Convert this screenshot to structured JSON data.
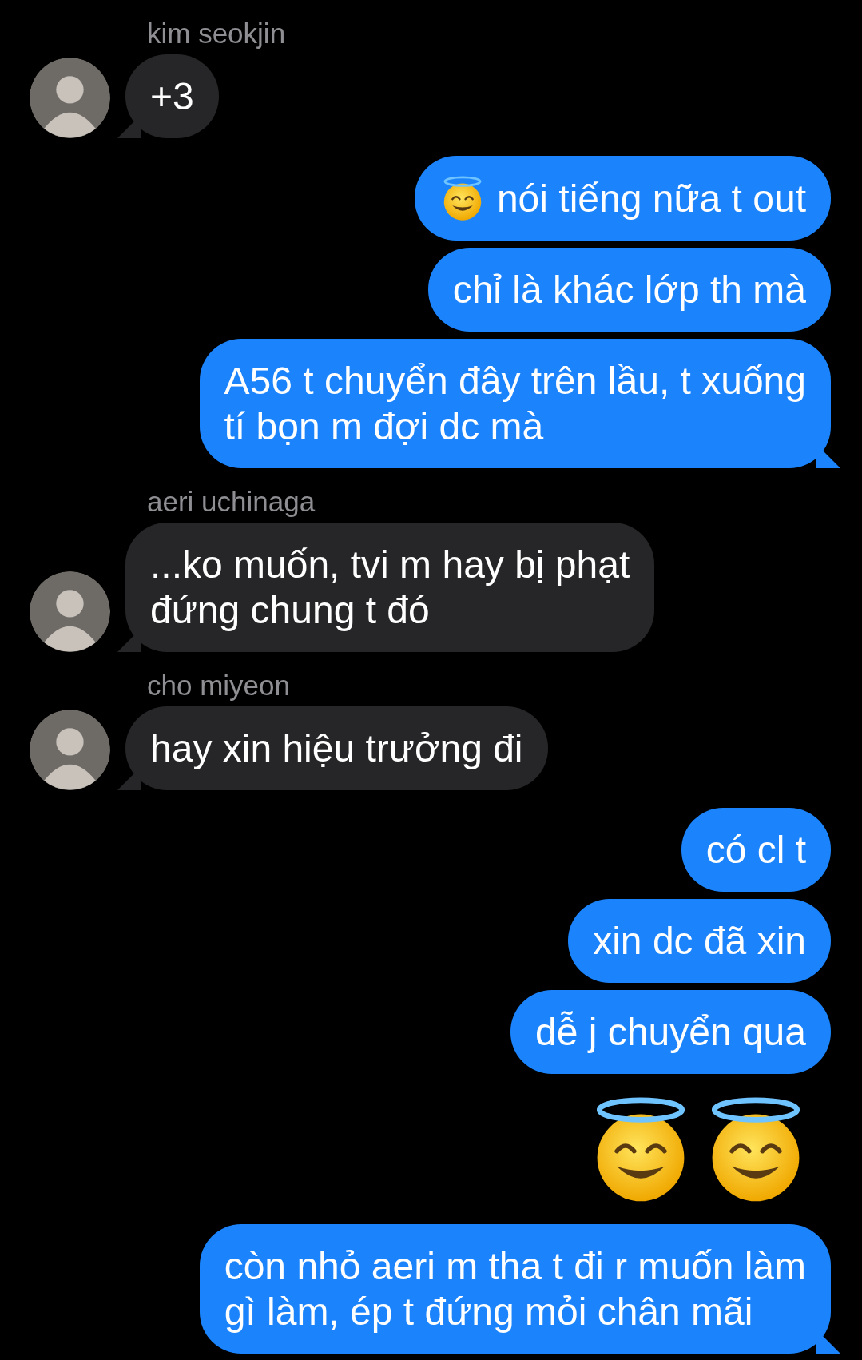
{
  "messages": [
    {
      "kind": "received",
      "sender": "kim seokjin",
      "bubbles": [
        {
          "text": "+3",
          "tail": true
        }
      ]
    },
    {
      "kind": "sent",
      "bubbles": [
        {
          "text": "nói tiếng nữa t out",
          "leading_icon": {
            "kind": "halo"
          },
          "tail": false
        },
        {
          "text": "chỉ là khác lớp th mà",
          "tail": false
        },
        {
          "text": "A56 t chuyển đây trên lầu, t xuống\ntí bọn m đợi dc mà",
          "tail": true
        }
      ]
    },
    {
      "kind": "received",
      "sender": "aeri uchinaga",
      "bubbles": [
        {
          "text": "...ko muốn, tvi m hay bị phạt\nđứng chung t đó",
          "tail": true
        }
      ]
    },
    {
      "kind": "received",
      "sender": "cho miyeon",
      "bubbles": [
        {
          "text": "hay xin hiệu trưởng đi",
          "tail": true
        }
      ]
    },
    {
      "kind": "sent",
      "bubbles": [
        {
          "text": "có cl t",
          "tail": false
        },
        {
          "text": "xin dc đã xin",
          "tail": false
        },
        {
          "text": "dễ j chuyển qua",
          "tail": false
        }
      ]
    },
    {
      "kind": "emoji",
      "emojis": [
        {
          "kind": "halo"
        },
        {
          "kind": "halo"
        }
      ]
    },
    {
      "kind": "sent",
      "bubbles": [
        {
          "text": "còn nhỏ aeri m tha t đi r muốn làm\ngì làm, ép t đứng mỏi chân mãi",
          "tail": true
        }
      ]
    }
  ]
}
